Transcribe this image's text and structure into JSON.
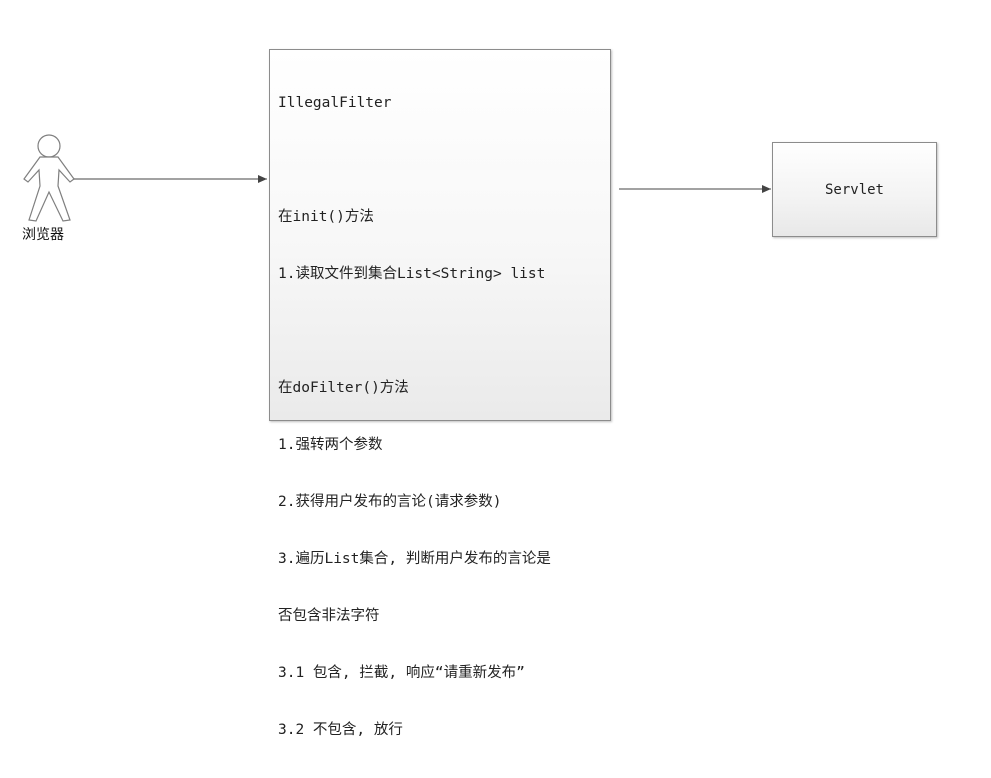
{
  "actor": {
    "label": "浏览器",
    "icon": "stick-figure-icon"
  },
  "filter": {
    "lines": [
      "IllegalFilter",
      "",
      "在init()方法",
      "1.读取文件到集合List<String> list",
      "",
      "在doFilter()方法",
      "1.强转两个参数",
      "2.获得用户发布的言论(请求参数)",
      "3.遍历List集合, 判断用户发布的言论是",
      "否包含非法字符",
      "3.1 包含, 拦截, 响应“请重新发布”",
      "3.2 不包含, 放行"
    ]
  },
  "servlet": {
    "label": "Servlet"
  },
  "colors": {
    "stroke": "#7f7f7f",
    "arrow": "#444444"
  }
}
